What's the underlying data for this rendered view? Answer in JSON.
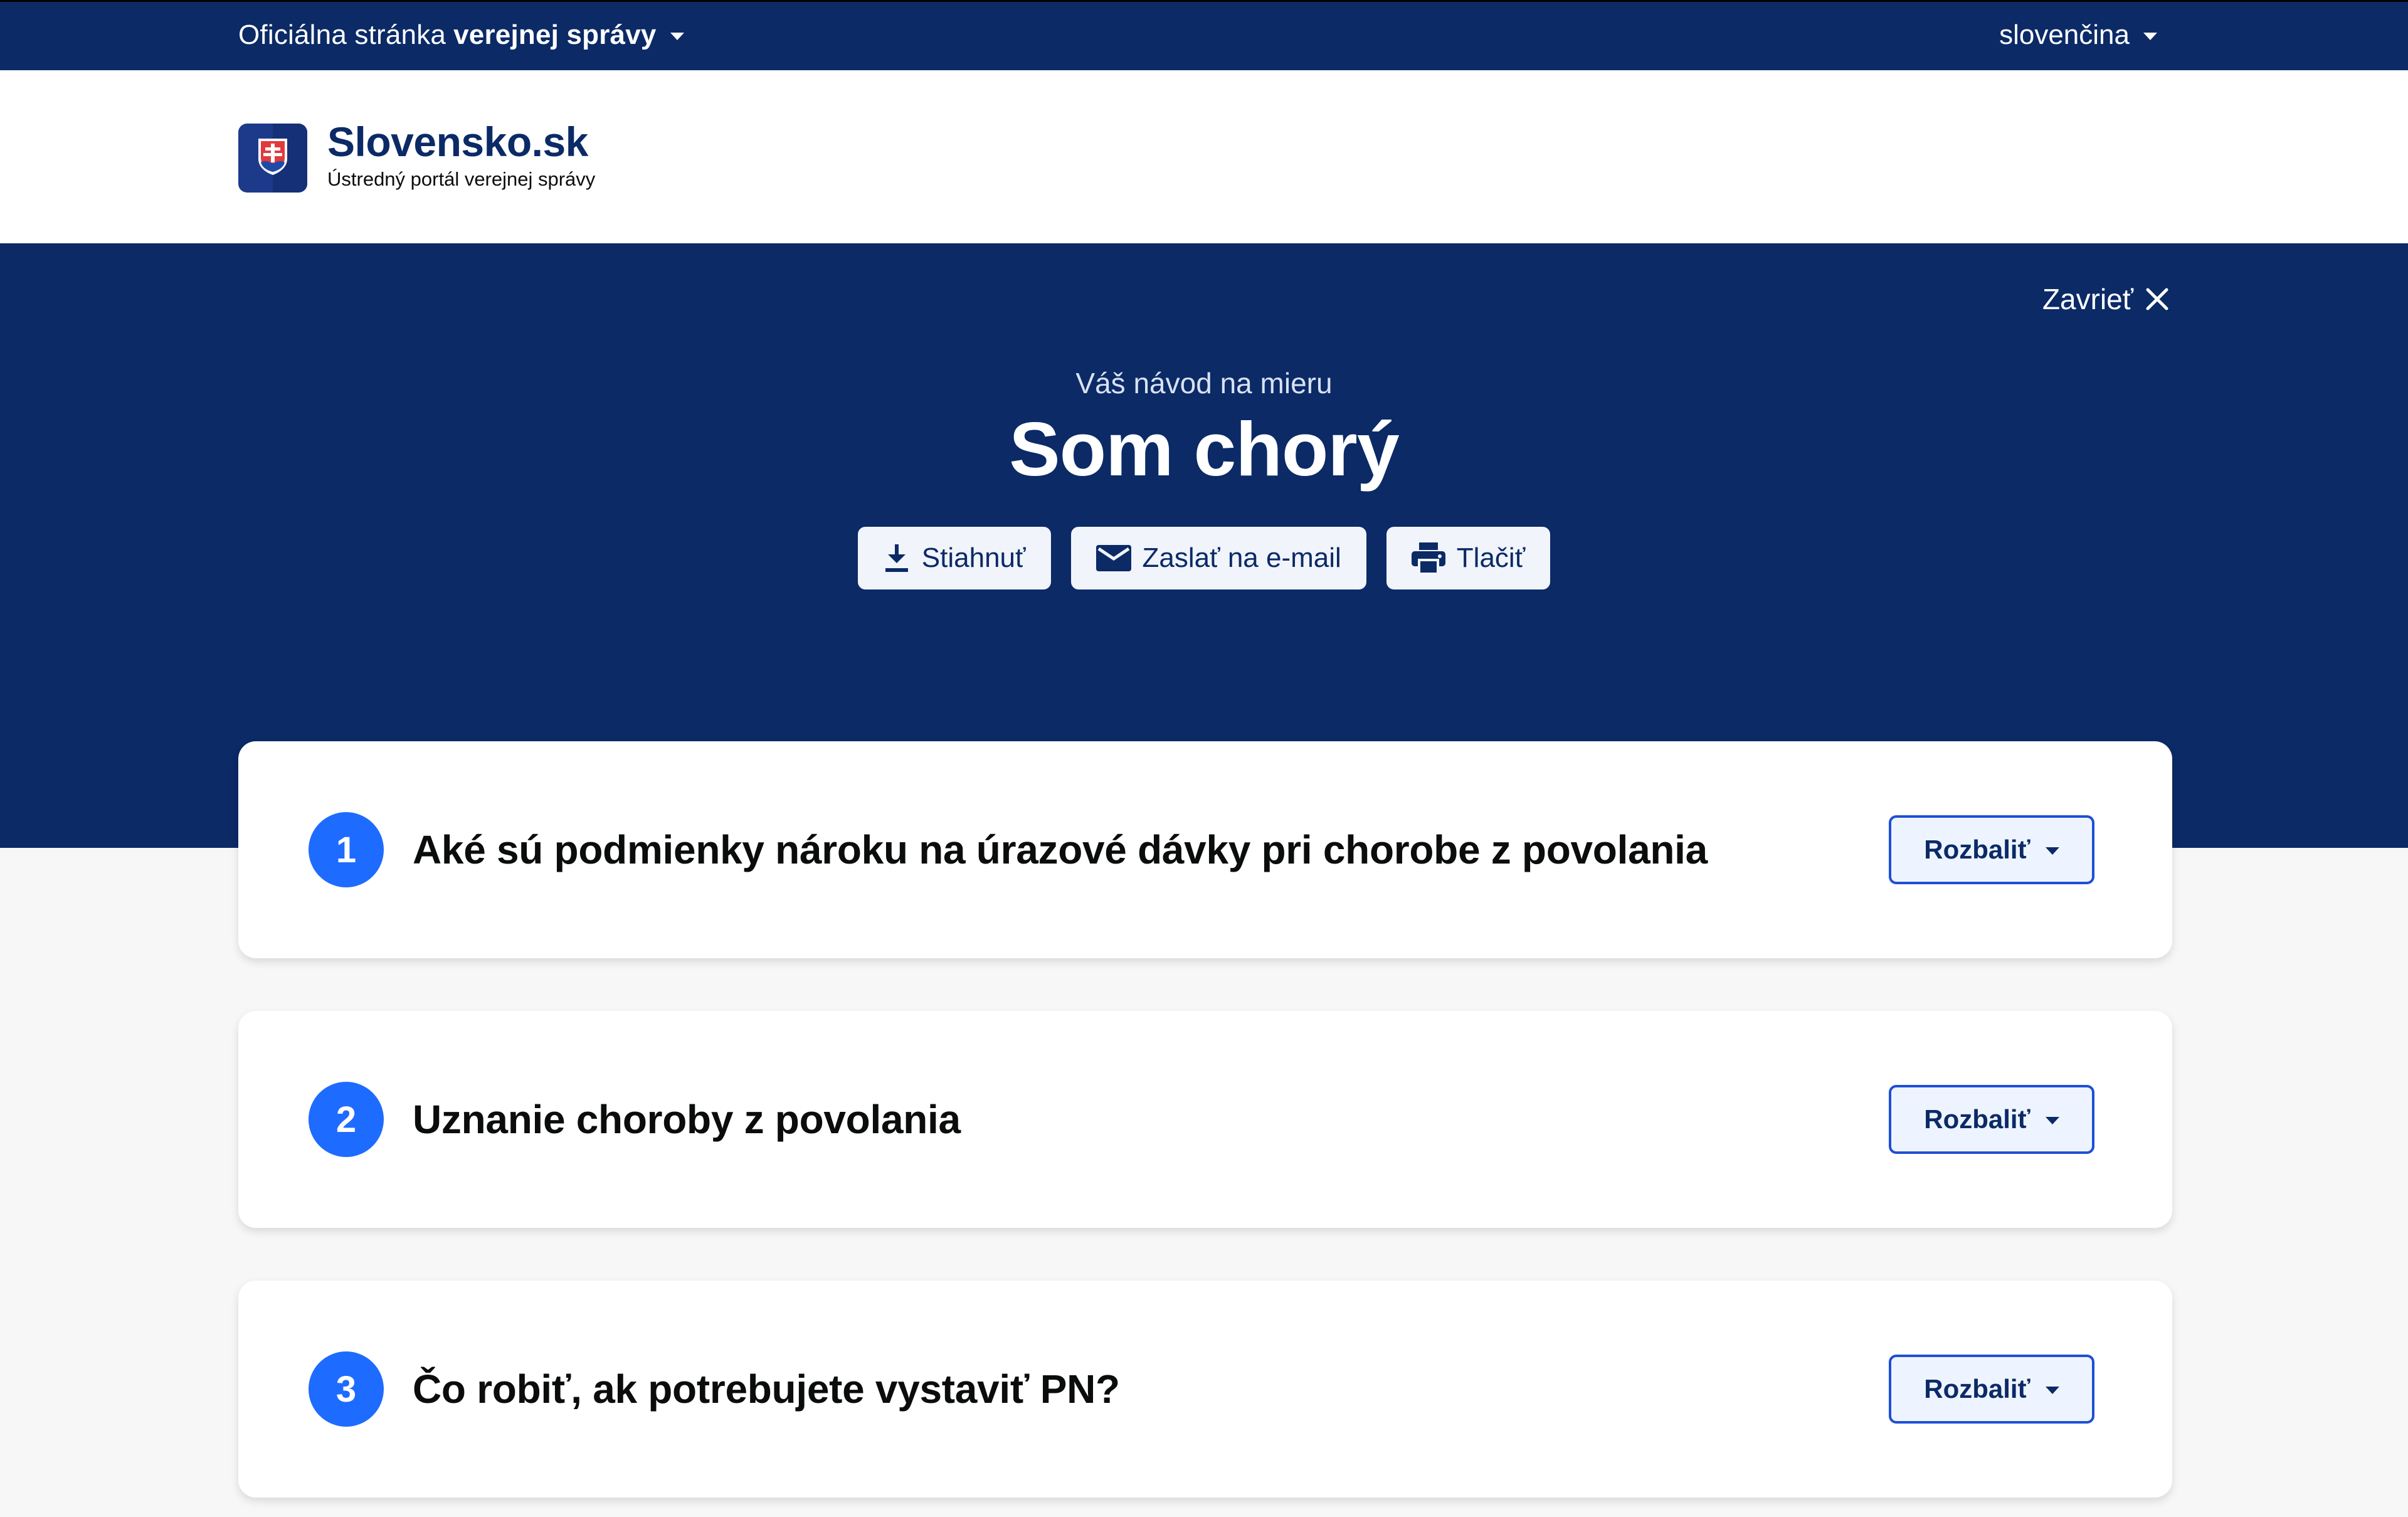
{
  "topbar": {
    "official_prefix": "Oficiálna stránka",
    "official_bold": "verejnej správy",
    "language": "slovenčina"
  },
  "header": {
    "brand_name": "Slovensko.sk",
    "brand_subtitle": "Ústredný portál verejnej správy"
  },
  "hero": {
    "close_label": "Zavrieť",
    "kicker": "Váš návod na mieru",
    "title": "Som chorý",
    "actions": [
      {
        "label": "Stiahnuť",
        "icon": "download-icon"
      },
      {
        "label": "Zaslať na e-mail",
        "icon": "mail-icon"
      },
      {
        "label": "Tlačiť",
        "icon": "print-icon"
      }
    ]
  },
  "steps": [
    {
      "number": "1",
      "title": "Aké sú podmienky nároku na úrazové dávky pri chorobe z povolania",
      "button": "Rozbaliť"
    },
    {
      "number": "2",
      "title": "Uznanie choroby z povolania",
      "button": "Rozbaliť"
    },
    {
      "number": "3",
      "title": "Čo robiť, ak potrebujete vystaviť PN?",
      "button": "Rozbaliť"
    }
  ],
  "colors": {
    "navy": "#0b2a66",
    "accent_blue": "#1e6bff",
    "button_bg": "#f1f4fb"
  }
}
